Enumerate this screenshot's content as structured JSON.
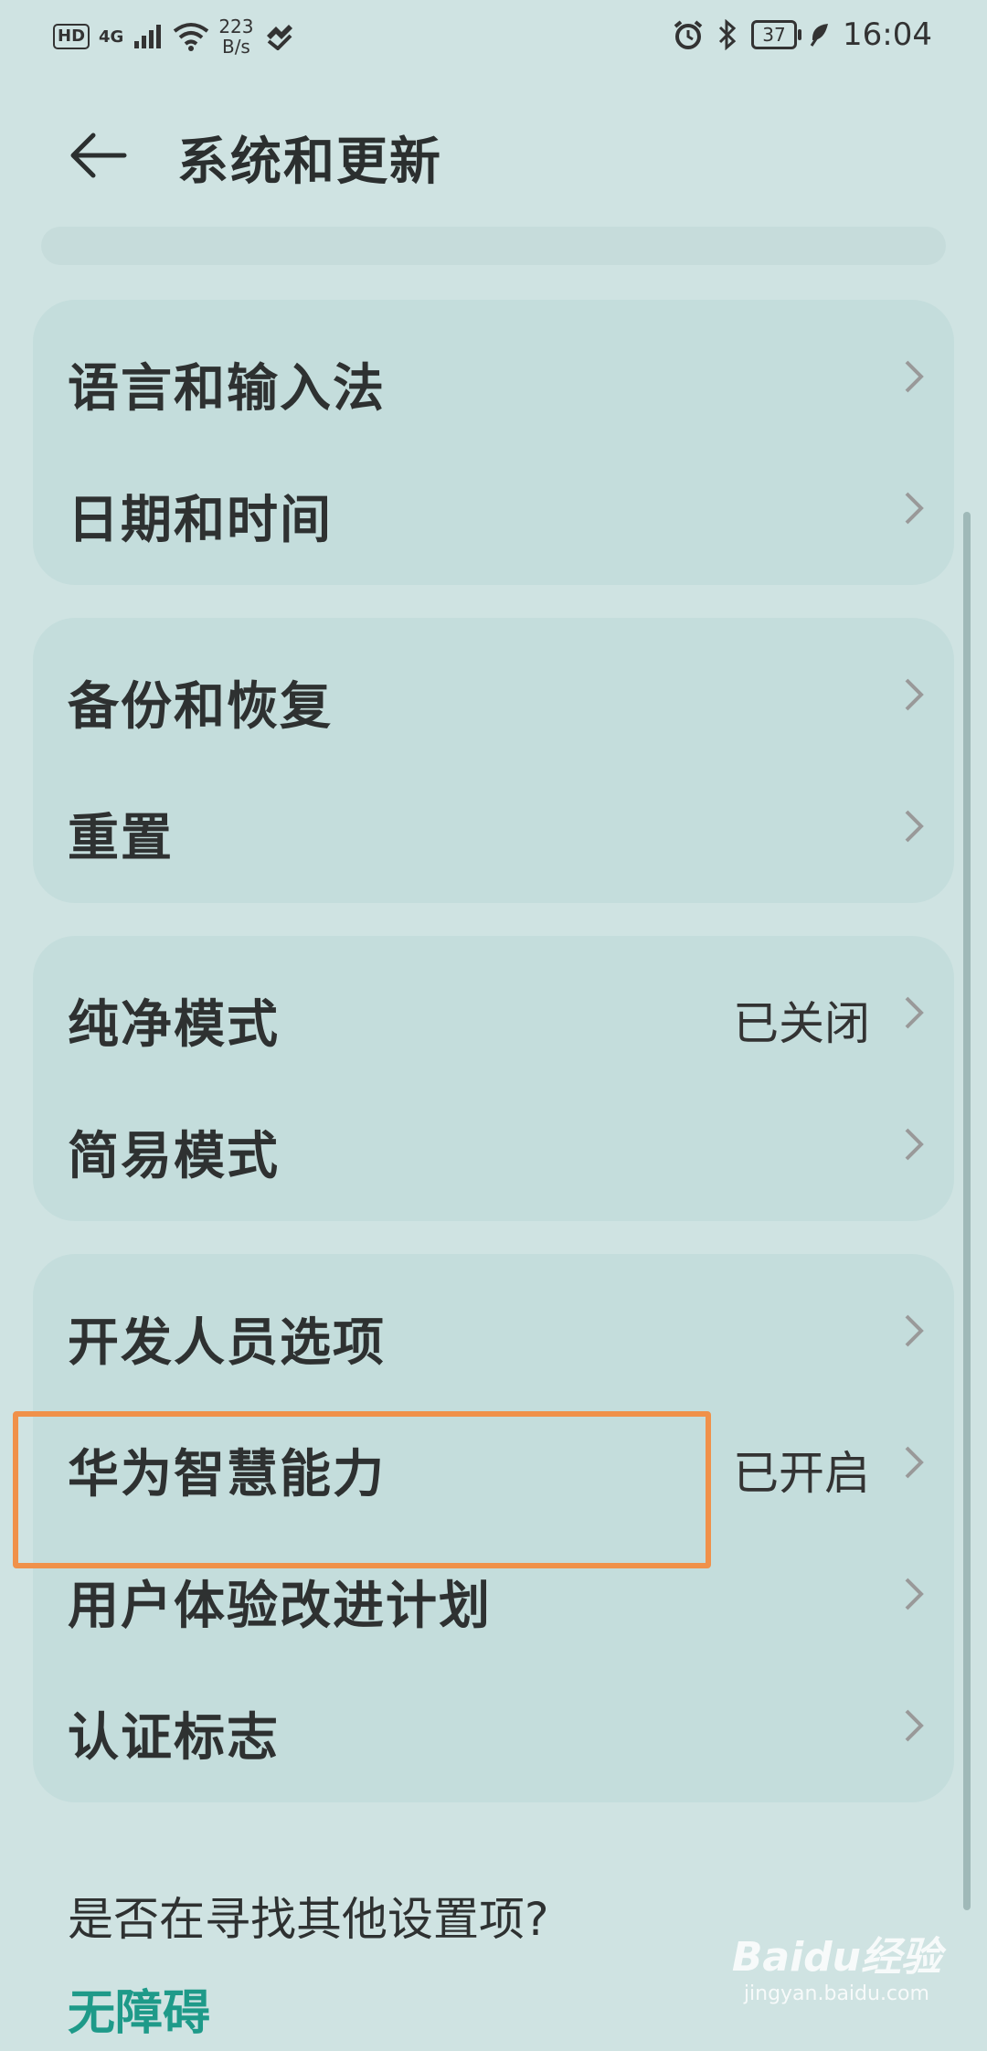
{
  "status_bar": {
    "hd": "HD",
    "signal": "4G",
    "speed_value": "223",
    "speed_unit": "B/s",
    "battery": "37",
    "time": "16:04",
    "icons": [
      "signal-icon",
      "wifi-icon",
      "hotspot-icon",
      "alarm-icon",
      "bluetooth-icon",
      "battery-icon",
      "leaf-icon"
    ]
  },
  "header": {
    "title": "系统和更新",
    "back_icon": "back-arrow-icon"
  },
  "groups": [
    {
      "items": [
        {
          "label": "语言和输入法"
        },
        {
          "label": "日期和时间"
        }
      ]
    },
    {
      "items": [
        {
          "label": "备份和恢复"
        },
        {
          "label": "重置"
        }
      ]
    },
    {
      "items": [
        {
          "label": "纯净模式",
          "value": "已关闭"
        },
        {
          "label": "简易模式"
        }
      ]
    },
    {
      "items": [
        {
          "label": "开发人员选项"
        },
        {
          "label": "华为智慧能力",
          "value": "已开启"
        },
        {
          "label": "用户体验改进计划"
        },
        {
          "label": "认证标志"
        }
      ]
    }
  ],
  "footer": {
    "question": "是否在寻找其他设置项?",
    "link": "无障碍"
  },
  "watermark": {
    "main": "Baidu经验",
    "sub": "jingyan.baidu.com"
  },
  "colors": {
    "background": "#cfe3e2",
    "card": "#c4dddc",
    "accent": "#1e9a89",
    "highlight": "#f0914a"
  }
}
